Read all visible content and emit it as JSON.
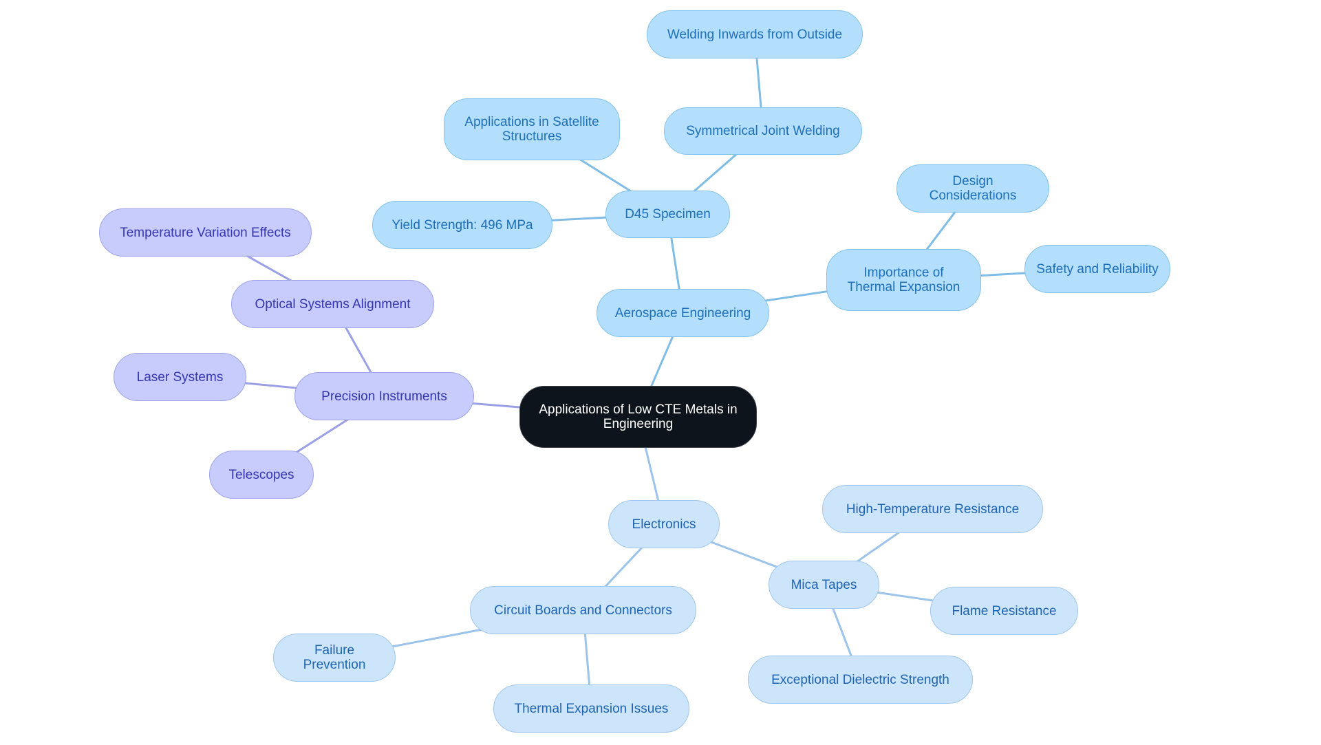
{
  "diagram": {
    "type": "mind-map",
    "root": {
      "id": "root",
      "label": "Applications of Low CTE Metals in Engineering"
    },
    "colors": {
      "root_fill": "#0e141b",
      "aerospace_fill": "#b3dffc",
      "aerospace_text": "#1d6fb8",
      "aerospace_edge": "#7fbde6",
      "electronics_fill": "#cde5fb",
      "electronics_text": "#1e63b0",
      "electronics_edge": "#9cc3ea",
      "precision_fill": "#c8ccfc",
      "precision_text": "#3535b0",
      "precision_edge": "#9a9fe6"
    },
    "nodes": [
      {
        "id": "root",
        "label": "Applications of Low CTE Metals in Engineering",
        "branch": "root"
      },
      {
        "id": "aero",
        "label": "Aerospace Engineering",
        "branch": "aero",
        "parent": "root"
      },
      {
        "id": "d45",
        "label": "D45 Specimen",
        "branch": "aero",
        "parent": "aero"
      },
      {
        "id": "yield",
        "label": "Yield Strength: 496 MPa",
        "branch": "aero",
        "parent": "d45"
      },
      {
        "id": "satellite",
        "label": "Applications in Satellite Structures",
        "branch": "aero",
        "parent": "d45"
      },
      {
        "id": "symm",
        "label": "Symmetrical Joint Welding",
        "branch": "aero",
        "parent": "d45"
      },
      {
        "id": "weldin",
        "label": "Welding Inwards from Outside",
        "branch": "aero",
        "parent": "symm"
      },
      {
        "id": "thermimp",
        "label": "Importance of Thermal Expansion",
        "branch": "aero",
        "parent": "aero"
      },
      {
        "id": "design",
        "label": "Design Considerations",
        "branch": "aero",
        "parent": "thermimp"
      },
      {
        "id": "safety",
        "label": "Safety and Reliability",
        "branch": "aero",
        "parent": "thermimp"
      },
      {
        "id": "prec",
        "label": "Precision Instruments",
        "branch": "prec",
        "parent": "root"
      },
      {
        "id": "optical",
        "label": "Optical Systems Alignment",
        "branch": "prec",
        "parent": "prec"
      },
      {
        "id": "tempvar",
        "label": "Temperature Variation Effects",
        "branch": "prec",
        "parent": "optical"
      },
      {
        "id": "laser",
        "label": "Laser Systems",
        "branch": "prec",
        "parent": "prec"
      },
      {
        "id": "telescopes",
        "label": "Telescopes",
        "branch": "prec",
        "parent": "prec"
      },
      {
        "id": "elec",
        "label": "Electronics",
        "branch": "elec",
        "parent": "root"
      },
      {
        "id": "circuit",
        "label": "Circuit Boards and Connectors",
        "branch": "elec",
        "parent": "elec"
      },
      {
        "id": "failure",
        "label": "Failure Prevention",
        "branch": "elec",
        "parent": "circuit"
      },
      {
        "id": "thermissues",
        "label": "Thermal Expansion Issues",
        "branch": "elec",
        "parent": "circuit"
      },
      {
        "id": "mica",
        "label": "Mica Tapes",
        "branch": "elec",
        "parent": "elec"
      },
      {
        "id": "hightemp",
        "label": "High-Temperature Resistance",
        "branch": "elec",
        "parent": "mica"
      },
      {
        "id": "flame",
        "label": "Flame Resistance",
        "branch": "elec",
        "parent": "mica"
      },
      {
        "id": "dielectric",
        "label": "Exceptional Dielectric Strength",
        "branch": "elec",
        "parent": "mica"
      }
    ]
  }
}
